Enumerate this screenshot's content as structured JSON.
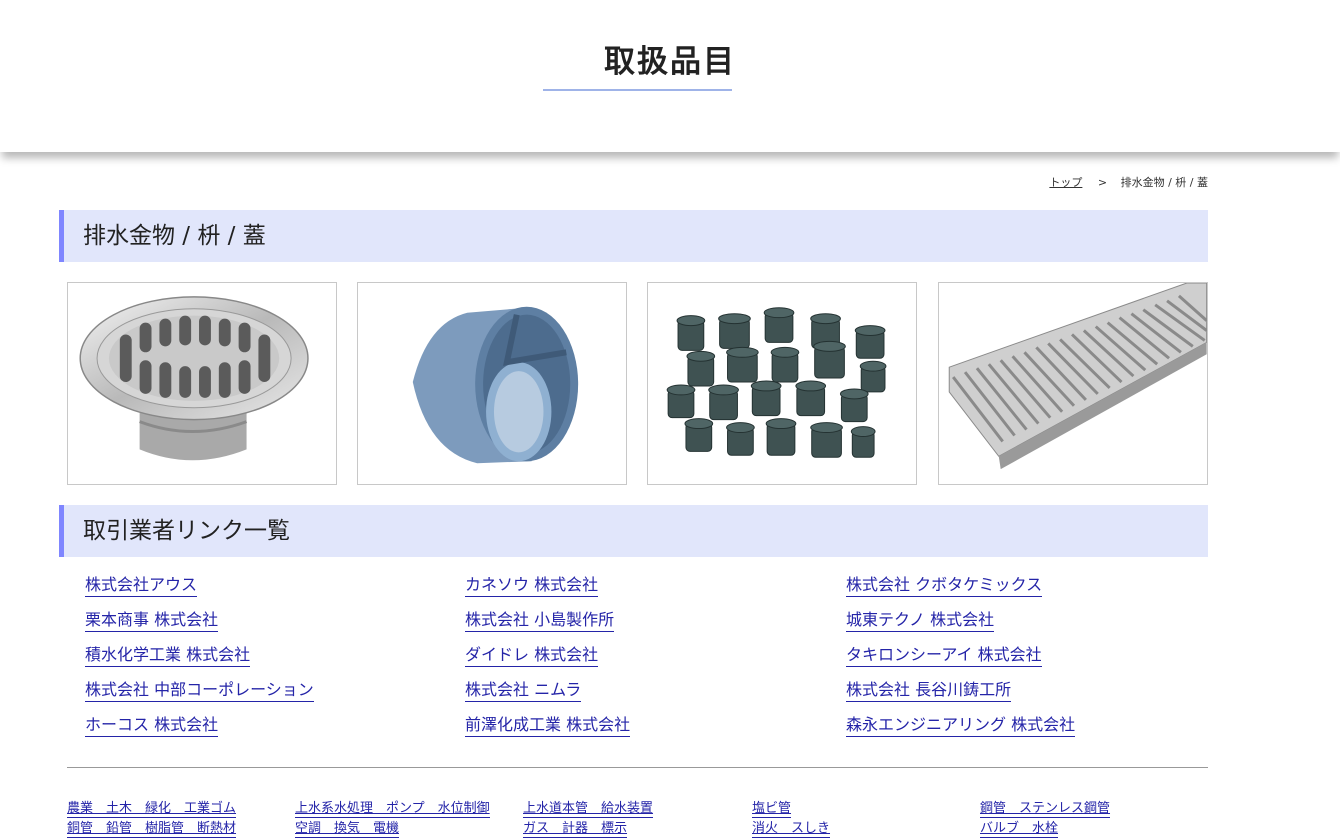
{
  "header": {
    "title": "取扱品目"
  },
  "breadcrumb": {
    "home": "トップ",
    "separator": ">",
    "current": "排水金物 / 枡 / 蓋"
  },
  "category": {
    "heading": "排水金物 / 枡 / 蓋",
    "images": [
      {
        "icon": "floor-drain-image"
      },
      {
        "icon": "pipe-fitting-image"
      },
      {
        "icon": "drain-basin-fittings-image"
      },
      {
        "icon": "grating-cover-image"
      }
    ]
  },
  "vendors": {
    "heading": "取引業者リンク一覧",
    "columns": [
      [
        "株式会社アウス",
        "栗本商事 株式会社",
        "積水化学工業 株式会社",
        "株式会社 中部コーポレーション",
        "ホーコス 株式会社"
      ],
      [
        "カネソウ 株式会社",
        "株式会社 小島製作所",
        "ダイドレ 株式会社",
        "株式会社 ニムラ",
        "前澤化成工業 株式会社"
      ],
      [
        "株式会社 クボタケミックス",
        "城東テクノ 株式会社",
        "タキロンシーアイ 株式会社",
        "株式会社 長谷川鋳工所",
        "森永エンジニアリング 株式会社"
      ]
    ]
  },
  "footer": {
    "links": [
      "農業　土木　緑化　工業ゴム",
      "上水系水処理　ポンプ　水位制御",
      "上水道本管　給水装置",
      "塩ビ管",
      "鋼管　ステンレス鋼管"
    ],
    "links_row2": [
      "銅管　鉛管　樹脂管　断熱材",
      "空調　換気　電機",
      "ガス　計器　標示",
      "消火　スしき",
      "バルブ　水栓"
    ]
  },
  "colors": {
    "accent": "#7f86ff",
    "heading_bg": "#e1e6fb",
    "link": "#2424a8",
    "title_underline": "#9fb3e8"
  }
}
